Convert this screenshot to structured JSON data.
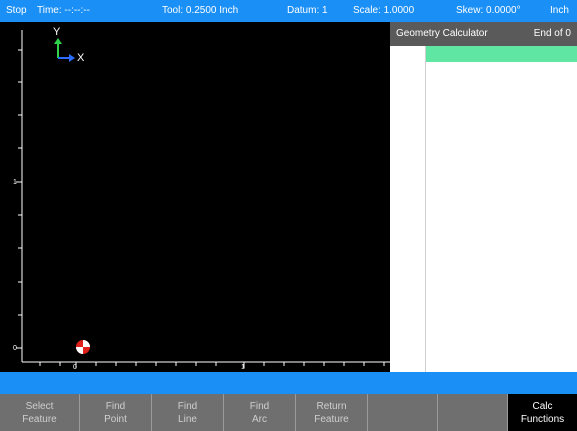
{
  "status_bar": {
    "state": "Stop",
    "time": "Time: --:--:--",
    "tool": "Tool: 0.2500 Inch",
    "datum": "Datum: 1",
    "scale": "Scale: 1.0000",
    "skew": "Skew: 0.0000°",
    "units": "Inch"
  },
  "graph": {
    "axis_y": "Y",
    "axis_x": "X",
    "y_ticks": [
      "1",
      "0"
    ],
    "x_ticks": [
      "0",
      "1"
    ],
    "colors": {
      "background": "#000000",
      "axis_y": "#2fd34a",
      "axis_x": "#2a6cff",
      "marker": "#e0201a"
    }
  },
  "panel": {
    "title": "Geometry Calculator",
    "status": "End of 0"
  },
  "softkeys": [
    {
      "line1": "Select",
      "line2": "Feature"
    },
    {
      "line1": "Find",
      "line2": "Point"
    },
    {
      "line1": "Find",
      "line2": "Line"
    },
    {
      "line1": "Find",
      "line2": "Arc"
    },
    {
      "line1": "Return",
      "line2": "Feature"
    },
    {
      "line1": "",
      "line2": ""
    },
    {
      "line1": "",
      "line2": ""
    },
    {
      "line1": "Calc",
      "line2": "Functions"
    }
  ],
  "colors": {
    "accent": "#1a8ff5",
    "highlight": "#5fe6a3",
    "panel_header": "#5a5a5a",
    "softkey_bg": "#6f6f6f"
  }
}
